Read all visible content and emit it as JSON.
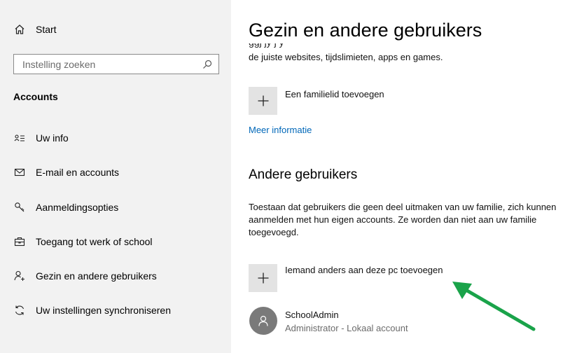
{
  "sidebar": {
    "home": {
      "label": "Start",
      "icon": "home-icon"
    },
    "search": {
      "placeholder": "Instelling zoeken",
      "icon": "search-icon"
    },
    "section_title": "Accounts",
    "items": [
      {
        "label": "Uw info",
        "icon": "person-card-icon"
      },
      {
        "label": "E-mail en accounts",
        "icon": "mail-icon"
      },
      {
        "label": "Aanmeldingsopties",
        "icon": "key-icon"
      },
      {
        "label": "Toegang tot werk of school",
        "icon": "briefcase-icon"
      },
      {
        "label": "Gezin en andere gebruikers",
        "icon": "add-person-icon"
      },
      {
        "label": "Uw instellingen synchroniseren",
        "icon": "sync-icon"
      }
    ]
  },
  "main": {
    "title": "Gezin en andere gebruikers",
    "family_desc": "de juiste websites, tijdslimieten, apps en games.",
    "add_family_label": "Een familielid toevoegen",
    "more_info_link": "Meer informatie",
    "other_users": {
      "heading": "Andere gebruikers",
      "description": "Toestaan dat gebruikers die geen deel uitmaken van uw familie, zich kunnen aanmelden met hun eigen accounts. Ze worden dan niet aan uw familie toegevoegd.",
      "add_other_label": "Iemand anders aan deze pc toevoegen",
      "users": [
        {
          "name": "SchoolAdmin",
          "role": "Administrator - Lokaal account",
          "icon": "user-avatar-icon"
        }
      ]
    }
  },
  "colors": {
    "sidebar_bg": "#f2f2f2",
    "link": "#0067b8",
    "add_button_bg": "#e3e3e3",
    "avatar_bg": "#7a7a7a",
    "annotation_arrow": "#1aa34a"
  }
}
